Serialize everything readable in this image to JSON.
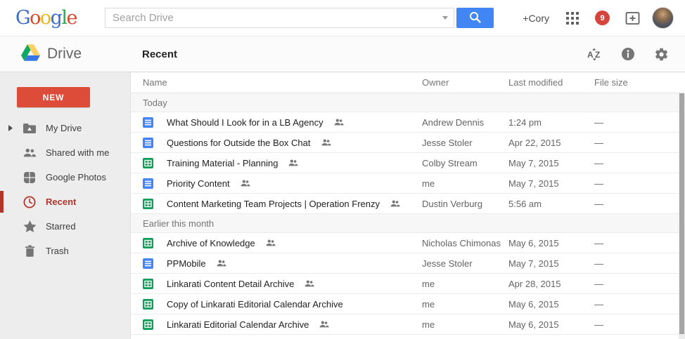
{
  "topbar": {
    "logo_letters": [
      {
        "ch": "G",
        "color": "#3b6dc8"
      },
      {
        "ch": "o",
        "color": "#d6482f"
      },
      {
        "ch": "o",
        "color": "#f0b613"
      },
      {
        "ch": "g",
        "color": "#3b6dc8"
      },
      {
        "ch": "l",
        "color": "#30a74e"
      },
      {
        "ch": "e",
        "color": "#d6482f"
      }
    ],
    "search_placeholder": "Search Drive",
    "account_name": "+Cory",
    "notification_count": "9"
  },
  "header": {
    "app_name": "Drive",
    "page_title": "Recent"
  },
  "sidebar": {
    "new_button_label": "NEW",
    "items": [
      {
        "label": "My Drive",
        "icon": "my-drive-folder-icon",
        "expandable": true,
        "active": false
      },
      {
        "label": "Shared with me",
        "icon": "shared-with-me-icon",
        "expandable": false,
        "active": false
      },
      {
        "label": "Google Photos",
        "icon": "google-photos-icon",
        "expandable": false,
        "active": false
      },
      {
        "label": "Recent",
        "icon": "recent-clock-icon",
        "expandable": false,
        "active": true
      },
      {
        "label": "Starred",
        "icon": "star-icon",
        "expandable": false,
        "active": false
      },
      {
        "label": "Trash",
        "icon": "trash-icon",
        "expandable": false,
        "active": false
      }
    ]
  },
  "table": {
    "columns": [
      "Name",
      "Owner",
      "Last modified",
      "File size"
    ],
    "sections": [
      {
        "label": "Today",
        "rows": [
          {
            "name": "What Should I Look for in a LB Agency",
            "type": "doc",
            "shared": true,
            "owner": "Andrew Dennis",
            "modified": "1:24 pm",
            "size": "—"
          },
          {
            "name": "Questions for Outside the Box Chat",
            "type": "doc",
            "shared": true,
            "owner": "Jesse Stoler",
            "modified": "Apr 22, 2015",
            "size": "—"
          },
          {
            "name": "Training Material - Planning",
            "type": "sheet",
            "shared": true,
            "owner": "Colby Stream",
            "modified": "May 7, 2015",
            "size": "—"
          },
          {
            "name": "Priority Content",
            "type": "doc",
            "shared": true,
            "owner": "me",
            "modified": "May 7, 2015",
            "size": "—"
          },
          {
            "name": "Content Marketing Team Projects | Operation Frenzy",
            "type": "sheet",
            "shared": true,
            "owner": "Dustin Verburg",
            "modified": "5:56 am",
            "size": "—"
          }
        ]
      },
      {
        "label": "Earlier this month",
        "rows": [
          {
            "name": "Archive of Knowledge",
            "type": "sheet",
            "shared": true,
            "owner": "Nicholas Chimonas",
            "modified": "May 6, 2015",
            "size": "—"
          },
          {
            "name": "PPMobile",
            "type": "doc",
            "shared": true,
            "owner": "Jesse Stoler",
            "modified": "May 7, 2015",
            "size": "—"
          },
          {
            "name": "Linkarati Content Detail Archive",
            "type": "sheet",
            "shared": true,
            "owner": "me",
            "modified": "Apr 28, 2015",
            "size": "—"
          },
          {
            "name": "Copy of Linkarati Editorial Calendar Archive",
            "type": "sheet",
            "shared": false,
            "owner": "me",
            "modified": "May 6, 2015",
            "size": "—"
          },
          {
            "name": "Linkarati Editorial Calendar Archive",
            "type": "sheet",
            "shared": true,
            "owner": "me",
            "modified": "May 6, 2015",
            "size": "—"
          }
        ]
      }
    ]
  },
  "colors": {
    "new_button_red": "#dd4b39",
    "recent_active_red": "#b2352a",
    "search_button_blue": "#4285f4",
    "doc_icon_blue": "#4285f4",
    "sheet_icon_green": "#0f9d58",
    "notification_badge_red": "#d6453c",
    "drive_logo_blue": "#3777e3",
    "drive_logo_yellow": "#ffcf63",
    "drive_logo_green": "#11a861",
    "icon_gray": "#757575"
  }
}
